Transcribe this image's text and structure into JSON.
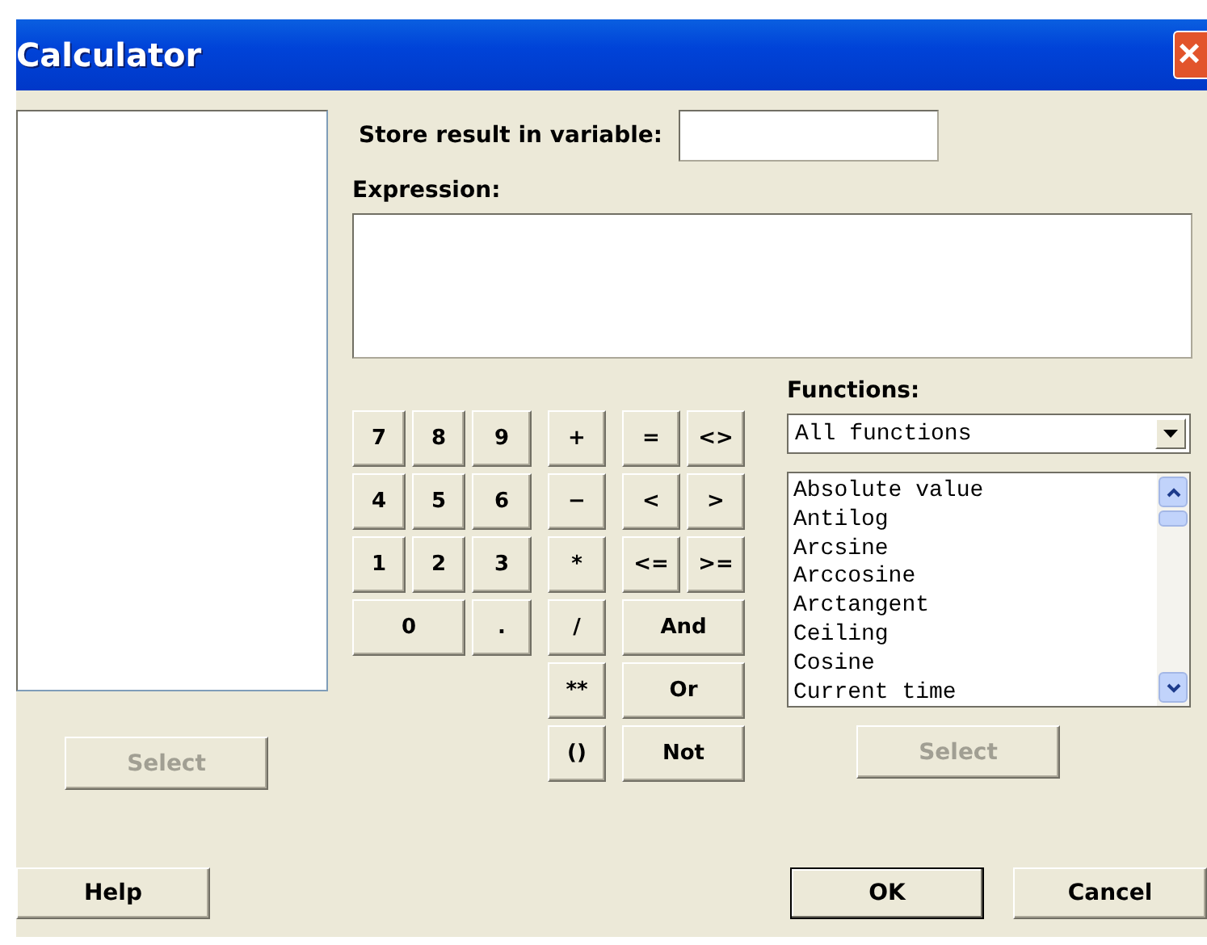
{
  "window": {
    "title": "Calculator",
    "close": "×"
  },
  "left_select": {
    "label": "Select",
    "disabled": true
  },
  "store": {
    "label": "Store result in variable:"
  },
  "expression": {
    "label": "Expression:"
  },
  "keypad": [
    "7",
    "8",
    "9",
    "+",
    "=",
    "<>",
    "4",
    "5",
    "6",
    "−",
    "<",
    ">",
    "1",
    "2",
    "3",
    "*",
    "<=",
    ">=",
    "0",
    ".",
    "/",
    "And",
    "**",
    "Or",
    "()",
    "Not"
  ],
  "functions": {
    "label": "Functions:",
    "category": "All functions",
    "items": [
      "Absolute value",
      "Antilog",
      "Arcsine",
      "Arccosine",
      "Arctangent",
      "Ceiling",
      "Cosine",
      "Current time"
    ]
  },
  "functions_select": {
    "label": "Select",
    "disabled": true
  },
  "buttons": [
    {
      "label": "Help",
      "default": false
    },
    {
      "label": "OK",
      "default": true
    },
    {
      "label": "Cancel",
      "default": false
    }
  ]
}
